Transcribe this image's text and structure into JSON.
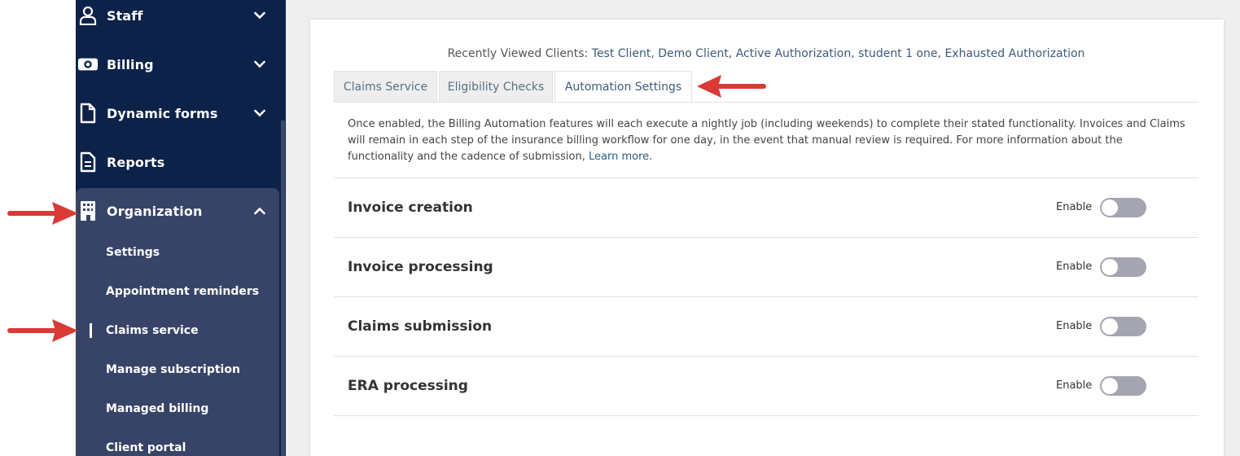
{
  "sidebar": {
    "items": [
      {
        "label": "Staff",
        "icon": "staff-icon"
      },
      {
        "label": "Billing",
        "icon": "billing-icon"
      },
      {
        "label": "Dynamic forms",
        "icon": "document-icon"
      },
      {
        "label": "Reports",
        "icon": "reports-icon"
      },
      {
        "label": "Organization",
        "icon": "building-icon"
      }
    ],
    "organization_subitems": [
      {
        "label": "Settings"
      },
      {
        "label": "Appointment reminders"
      },
      {
        "label": "Claims service",
        "active": true
      },
      {
        "label": "Manage subscription"
      },
      {
        "label": "Managed billing"
      },
      {
        "label": "Client portal"
      }
    ]
  },
  "recent": {
    "prefix": "Recently Viewed Clients:",
    "clients": [
      "Test Client",
      "Demo Client",
      "Active Authorization",
      "student 1 one",
      "Exhausted Authorization"
    ]
  },
  "tabs": [
    {
      "label": "Claims Service"
    },
    {
      "label": "Eligibility Checks"
    },
    {
      "label": "Automation Settings",
      "active": true
    }
  ],
  "description": {
    "text": "Once enabled, the Billing Automation features will each execute a nightly job (including weekends) to complete their stated functionality. Invoices and Claims will remain in each step of the insurance billing workflow for one day, in the event that manual review is required. For more information about the functionality and the cadence of submission,",
    "link": "Learn more",
    "suffix": "."
  },
  "settings": [
    {
      "title": "Invoice creation",
      "enable_label": "Enable",
      "enabled": false
    },
    {
      "title": "Invoice processing",
      "enable_label": "Enable",
      "enabled": false
    },
    {
      "title": "Claims submission",
      "enable_label": "Enable",
      "enabled": false
    },
    {
      "title": "ERA processing",
      "enable_label": "Enable",
      "enabled": false
    }
  ],
  "colors": {
    "sidebar_bg": "#0c2248",
    "submenu_bg": "#374468",
    "arrow": "#d93a35",
    "toggle_off": "#a5a5b2"
  }
}
